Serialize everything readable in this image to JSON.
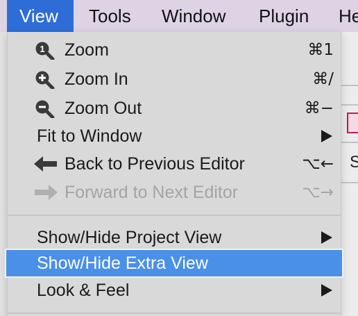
{
  "menubar": {
    "items": [
      {
        "label": "View",
        "active": true
      },
      {
        "label": "Tools"
      },
      {
        "label": "Window"
      },
      {
        "label": "Plugin"
      },
      {
        "label": "He"
      }
    ]
  },
  "background": {
    "letter": "S"
  },
  "menu": {
    "items": [
      {
        "label": "Zoom",
        "icon": "zoom-reset-icon",
        "shortcut": "⌘1"
      },
      {
        "label": "Zoom In",
        "icon": "zoom-in-icon",
        "shortcut": "⌘/"
      },
      {
        "label": "Zoom Out",
        "icon": "zoom-out-icon",
        "shortcut": "⌘−"
      },
      {
        "label": "Fit to Window",
        "submenu": true
      },
      {
        "label": "Back to Previous Editor",
        "icon": "arrow-left-icon",
        "shortcut": "⌥←"
      },
      {
        "label": "Forward to Next Editor",
        "icon": "arrow-right-icon",
        "shortcut": "⌥→",
        "disabled": true
      },
      {
        "label": "Show/Hide Project View",
        "submenu": true
      },
      {
        "label": "Show/Hide Extra View",
        "highlighted": true
      },
      {
        "label": "Look & Feel",
        "submenu": true
      }
    ]
  },
  "colors": {
    "menubar": "#ddd3e4",
    "menubar_active": "#2e6dd8",
    "menu_bg": "#d9d9d9",
    "highlight": "#4a90e8",
    "disabled_text": "#a4a4a4"
  }
}
